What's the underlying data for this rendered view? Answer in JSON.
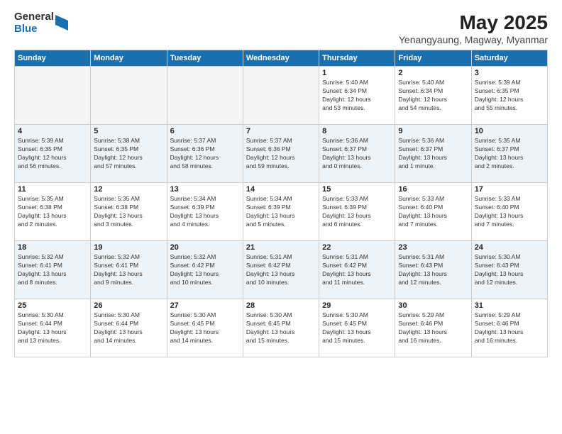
{
  "logo": {
    "general": "General",
    "blue": "Blue"
  },
  "title": "May 2025",
  "subtitle": "Yenangyaung, Magway, Myanmar",
  "headers": [
    "Sunday",
    "Monday",
    "Tuesday",
    "Wednesday",
    "Thursday",
    "Friday",
    "Saturday"
  ],
  "weeks": [
    [
      {
        "day": "",
        "info": ""
      },
      {
        "day": "",
        "info": ""
      },
      {
        "day": "",
        "info": ""
      },
      {
        "day": "",
        "info": ""
      },
      {
        "day": "1",
        "info": "Sunrise: 5:40 AM\nSunset: 6:34 PM\nDaylight: 12 hours\nand 53 minutes."
      },
      {
        "day": "2",
        "info": "Sunrise: 5:40 AM\nSunset: 6:34 PM\nDaylight: 12 hours\nand 54 minutes."
      },
      {
        "day": "3",
        "info": "Sunrise: 5:39 AM\nSunset: 6:35 PM\nDaylight: 12 hours\nand 55 minutes."
      }
    ],
    [
      {
        "day": "4",
        "info": "Sunrise: 5:39 AM\nSunset: 6:35 PM\nDaylight: 12 hours\nand 56 minutes."
      },
      {
        "day": "5",
        "info": "Sunrise: 5:38 AM\nSunset: 6:35 PM\nDaylight: 12 hours\nand 57 minutes."
      },
      {
        "day": "6",
        "info": "Sunrise: 5:37 AM\nSunset: 6:36 PM\nDaylight: 12 hours\nand 58 minutes."
      },
      {
        "day": "7",
        "info": "Sunrise: 5:37 AM\nSunset: 6:36 PM\nDaylight: 12 hours\nand 59 minutes."
      },
      {
        "day": "8",
        "info": "Sunrise: 5:36 AM\nSunset: 6:37 PM\nDaylight: 13 hours\nand 0 minutes."
      },
      {
        "day": "9",
        "info": "Sunrise: 5:36 AM\nSunset: 6:37 PM\nDaylight: 13 hours\nand 1 minute."
      },
      {
        "day": "10",
        "info": "Sunrise: 5:35 AM\nSunset: 6:37 PM\nDaylight: 13 hours\nand 2 minutes."
      }
    ],
    [
      {
        "day": "11",
        "info": "Sunrise: 5:35 AM\nSunset: 6:38 PM\nDaylight: 13 hours\nand 2 minutes."
      },
      {
        "day": "12",
        "info": "Sunrise: 5:35 AM\nSunset: 6:38 PM\nDaylight: 13 hours\nand 3 minutes."
      },
      {
        "day": "13",
        "info": "Sunrise: 5:34 AM\nSunset: 6:39 PM\nDaylight: 13 hours\nand 4 minutes."
      },
      {
        "day": "14",
        "info": "Sunrise: 5:34 AM\nSunset: 6:39 PM\nDaylight: 13 hours\nand 5 minutes."
      },
      {
        "day": "15",
        "info": "Sunrise: 5:33 AM\nSunset: 6:39 PM\nDaylight: 13 hours\nand 6 minutes."
      },
      {
        "day": "16",
        "info": "Sunrise: 5:33 AM\nSunset: 6:40 PM\nDaylight: 13 hours\nand 7 minutes."
      },
      {
        "day": "17",
        "info": "Sunrise: 5:33 AM\nSunset: 6:40 PM\nDaylight: 13 hours\nand 7 minutes."
      }
    ],
    [
      {
        "day": "18",
        "info": "Sunrise: 5:32 AM\nSunset: 6:41 PM\nDaylight: 13 hours\nand 8 minutes."
      },
      {
        "day": "19",
        "info": "Sunrise: 5:32 AM\nSunset: 6:41 PM\nDaylight: 13 hours\nand 9 minutes."
      },
      {
        "day": "20",
        "info": "Sunrise: 5:32 AM\nSunset: 6:42 PM\nDaylight: 13 hours\nand 10 minutes."
      },
      {
        "day": "21",
        "info": "Sunrise: 5:31 AM\nSunset: 6:42 PM\nDaylight: 13 hours\nand 10 minutes."
      },
      {
        "day": "22",
        "info": "Sunrise: 5:31 AM\nSunset: 6:42 PM\nDaylight: 13 hours\nand 11 minutes."
      },
      {
        "day": "23",
        "info": "Sunrise: 5:31 AM\nSunset: 6:43 PM\nDaylight: 13 hours\nand 12 minutes."
      },
      {
        "day": "24",
        "info": "Sunrise: 5:30 AM\nSunset: 6:43 PM\nDaylight: 13 hours\nand 12 minutes."
      }
    ],
    [
      {
        "day": "25",
        "info": "Sunrise: 5:30 AM\nSunset: 6:44 PM\nDaylight: 13 hours\nand 13 minutes."
      },
      {
        "day": "26",
        "info": "Sunrise: 5:30 AM\nSunset: 6:44 PM\nDaylight: 13 hours\nand 14 minutes."
      },
      {
        "day": "27",
        "info": "Sunrise: 5:30 AM\nSunset: 6:45 PM\nDaylight: 13 hours\nand 14 minutes."
      },
      {
        "day": "28",
        "info": "Sunrise: 5:30 AM\nSunset: 6:45 PM\nDaylight: 13 hours\nand 15 minutes."
      },
      {
        "day": "29",
        "info": "Sunrise: 5:30 AM\nSunset: 6:45 PM\nDaylight: 13 hours\nand 15 minutes."
      },
      {
        "day": "30",
        "info": "Sunrise: 5:29 AM\nSunset: 6:46 PM\nDaylight: 13 hours\nand 16 minutes."
      },
      {
        "day": "31",
        "info": "Sunrise: 5:29 AM\nSunset: 6:46 PM\nDaylight: 13 hours\nand 16 minutes."
      }
    ]
  ]
}
